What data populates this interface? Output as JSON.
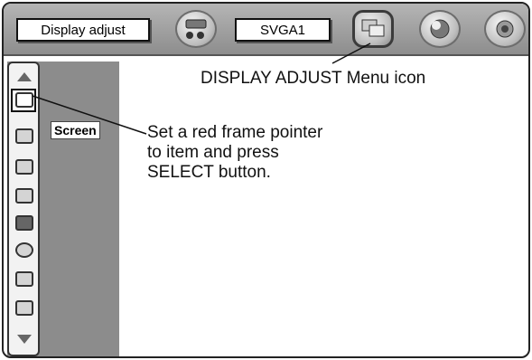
{
  "menu_bar": {
    "display_adjust_label": "Display adjust",
    "signal_label": "SVGA1",
    "icons": [
      "pc-adjust-icon",
      "display-adjust-icon",
      "image-select-icon",
      "sound-icon"
    ]
  },
  "sidebar": {
    "item_label": "Screen",
    "icons": [
      "scroll-up-icon",
      "screen-icon",
      "horizontal-position-icon",
      "vertical-position-icon",
      "monitor-icon",
      "wide-icon",
      "keystone-icon",
      "custom-icon",
      "reset-icon",
      "scroll-down-icon"
    ]
  },
  "annotations": {
    "menu_icon_caption": "DISPLAY ADJUST Menu icon",
    "pointer_line1": "Set a red frame pointer",
    "pointer_line2": "to item and press",
    "pointer_line3": "SELECT button."
  },
  "colors": {
    "menu_bar": "#9e9e9e",
    "sidebar": "#8c8c8c",
    "frame": "#222222"
  }
}
